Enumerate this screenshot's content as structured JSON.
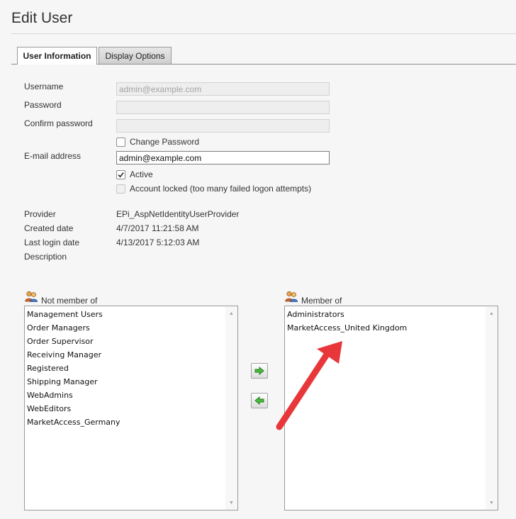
{
  "page": {
    "title": "Edit User"
  },
  "tabs": [
    {
      "label": "User Information",
      "selected": true
    },
    {
      "label": "Display Options",
      "selected": false
    }
  ],
  "form": {
    "username": {
      "label": "Username",
      "value": "admin@example.com"
    },
    "password": {
      "label": "Password",
      "value": ""
    },
    "confirm_password": {
      "label": "Confirm password",
      "value": ""
    },
    "change_password": {
      "label": "Change Password",
      "checked": false
    },
    "email": {
      "label": "E-mail address",
      "value": "admin@example.com"
    },
    "active": {
      "label": "Active",
      "checked": true
    },
    "account_locked": {
      "label": "Account locked (too many failed logon attempts)",
      "checked": false
    }
  },
  "info": {
    "provider": {
      "label": "Provider",
      "value": "EPi_AspNetIdentityUserProvider"
    },
    "created": {
      "label": "Created date",
      "value": "4/7/2017 11:21:58 AM"
    },
    "last_login": {
      "label": "Last login date",
      "value": "4/13/2017 5:12:03 AM"
    },
    "description": {
      "label": "Description",
      "value": ""
    }
  },
  "groups": {
    "not_member": {
      "label": "Not member of",
      "items": [
        "Management Users",
        "Order Managers",
        "Order Supervisor",
        "Receiving Manager",
        "Registered",
        "Shipping Manager",
        "WebAdmins",
        "WebEditors",
        "MarketAccess_Germany"
      ]
    },
    "member": {
      "label": "Member of",
      "items": [
        "Administrators",
        "MarketAccess_United Kingdom"
      ]
    }
  },
  "icons": {
    "add": "arrow-right-icon",
    "remove": "arrow-left-icon",
    "group": "users-group-icon"
  },
  "colors": {
    "annotation": "#e8373a",
    "arrow_green": "#3aa935"
  }
}
